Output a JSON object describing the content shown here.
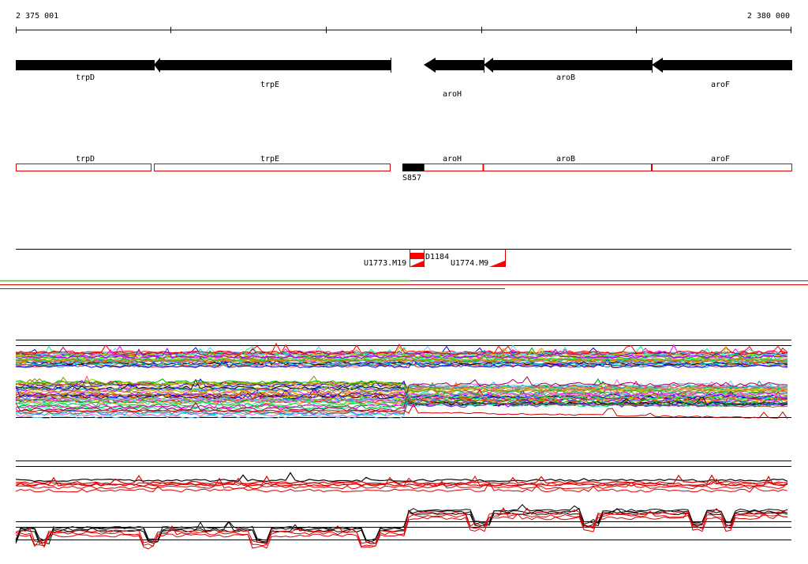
{
  "ruler": {
    "start_label": "2 375 001",
    "end_label": "2 380 000",
    "start": 2375001,
    "end": 2380000
  },
  "colors": {
    "gene_fill": "#000000",
    "cds_box": "#dd0000",
    "feature_red": "#ff0000",
    "green_line": "#33cc33",
    "red_line": "#dd0000",
    "black": "#000000",
    "white": "#ffffff"
  },
  "genes": [
    {
      "name": "trpD",
      "start": 2375001,
      "end": 2375894,
      "strand": "-"
    },
    {
      "name": "trpE",
      "start": 2375894,
      "end": 2377424,
      "strand": "-"
    },
    {
      "name": "aroH",
      "start": 2377624,
      "end": 2377994,
      "strand": "-"
    },
    {
      "name": "aroB",
      "start": 2377994,
      "end": 2379084,
      "strand": "-"
    },
    {
      "name": "aroF",
      "start": 2379084,
      "end": 2380000,
      "strand": "-"
    }
  ],
  "cds_boxes": [
    {
      "name": "trpD",
      "start": 2375001,
      "end": 2375874
    },
    {
      "name": "trpE",
      "start": 2375884,
      "end": 2377424
    },
    {
      "name": "aroH",
      "start": 2377624,
      "end": 2377994
    },
    {
      "name": "aroB",
      "start": 2377994,
      "end": 2379084
    },
    {
      "name": "aroF",
      "start": 2379084,
      "end": 2380000
    }
  ],
  "solid_feature": {
    "name": "S857",
    "start": 2377474,
    "end": 2377604
  },
  "primers": [
    {
      "name": "U1773.M19"
    },
    {
      "name": "D1184"
    },
    {
      "name": "U1774.M9"
    }
  ]
}
